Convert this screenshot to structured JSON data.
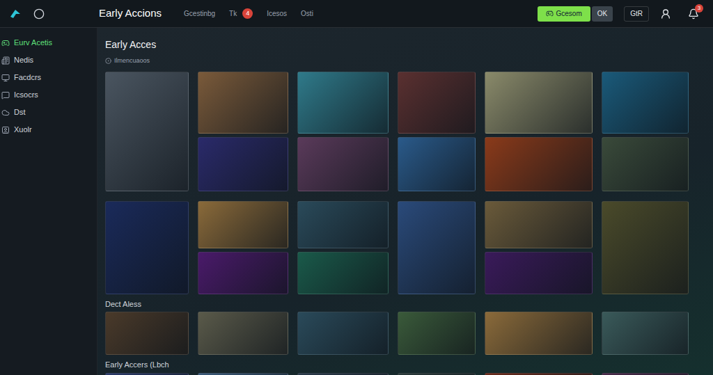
{
  "app": {
    "title": "Early Accions"
  },
  "nav": [
    {
      "label": "Gcestinbg",
      "selected": false
    },
    {
      "label": "Tk",
      "selected": false,
      "badge": "4"
    },
    {
      "label": "Icesos",
      "selected": false
    },
    {
      "label": "Osti",
      "selected": false
    }
  ],
  "actions": {
    "primary": "Gcesom",
    "secondary": "OK",
    "account": "GtR",
    "notifications": "3"
  },
  "sidebar": {
    "items": [
      {
        "label": "Eurv Acetis",
        "selected": true
      },
      {
        "label": "Nedis",
        "selected": false
      },
      {
        "label": "Facdcrs",
        "selected": false
      },
      {
        "label": "Icsocrs",
        "selected": false
      },
      {
        "label": "Dst",
        "selected": false
      },
      {
        "label": "Xuolr",
        "selected": false
      }
    ]
  },
  "sections": [
    {
      "title": "Early Acces",
      "subtitle": "Ilmencuaoos",
      "kind": "grid",
      "columns": [
        {
          "kind": "tall",
          "tiles": [
            {
              "color": "#4a5560"
            }
          ]
        },
        {
          "kind": "stack",
          "tiles": [
            {
              "color": "#7a5a3a"
            },
            {
              "color": "#2a2a6a"
            }
          ]
        },
        {
          "kind": "stack",
          "tiles": [
            {
              "color": "#2f7a8a"
            },
            {
              "color": "#5a3a5a"
            }
          ]
        },
        {
          "kind": "stack",
          "tiles": [
            {
              "color": "#5a3030"
            },
            {
              "color": "#2a5a8a"
            }
          ]
        },
        {
          "kind": "stack",
          "tiles": [
            {
              "color": "#8a8a6a"
            },
            {
              "color": "#8a3a1a"
            }
          ]
        },
        {
          "kind": "stack",
          "tiles": [
            {
              "color": "#1a5a7a"
            },
            {
              "color": "#3a4a3a"
            }
          ]
        }
      ]
    },
    {
      "kind": "grid",
      "columns": [
        {
          "kind": "tall",
          "tiles": [
            {
              "color": "#1a2a5a"
            }
          ]
        },
        {
          "kind": "stack",
          "tiles": [
            {
              "color": "#8a6a3a"
            },
            {
              "color": "#4a1a6a"
            }
          ]
        },
        {
          "kind": "stack",
          "tiles": [
            {
              "color": "#2a4a5a"
            },
            {
              "color": "#1a5a4a"
            }
          ]
        },
        {
          "kind": "tall",
          "tiles": [
            {
              "color": "#2a4a7a"
            }
          ]
        },
        {
          "kind": "stack",
          "tiles": [
            {
              "color": "#6a5a3a"
            },
            {
              "color": "#3a1a5a"
            }
          ]
        },
        {
          "kind": "tall",
          "tiles": [
            {
              "color": "#4a4a2a"
            }
          ]
        }
      ]
    },
    {
      "title": "Dect Aless",
      "kind": "row",
      "tiles": [
        {
          "color": "#4a3a2a"
        },
        {
          "color": "#5a5a4a"
        },
        {
          "color": "#2a4a5a"
        },
        {
          "color": "#3a5a3a"
        },
        {
          "color": "#8a6a3a"
        },
        {
          "color": "#3a5a5a"
        }
      ]
    },
    {
      "title": "Early Accers (Lbch",
      "kind": "row",
      "tiles": [
        {
          "color": "#2a3a6a"
        },
        {
          "color": "#3a5a7a"
        },
        {
          "color": "#2a3a4a"
        },
        {
          "color": "#2a3a3a"
        },
        {
          "color": "#6a2a1a"
        },
        {
          "color": "#4a2a4a"
        }
      ]
    }
  ]
}
